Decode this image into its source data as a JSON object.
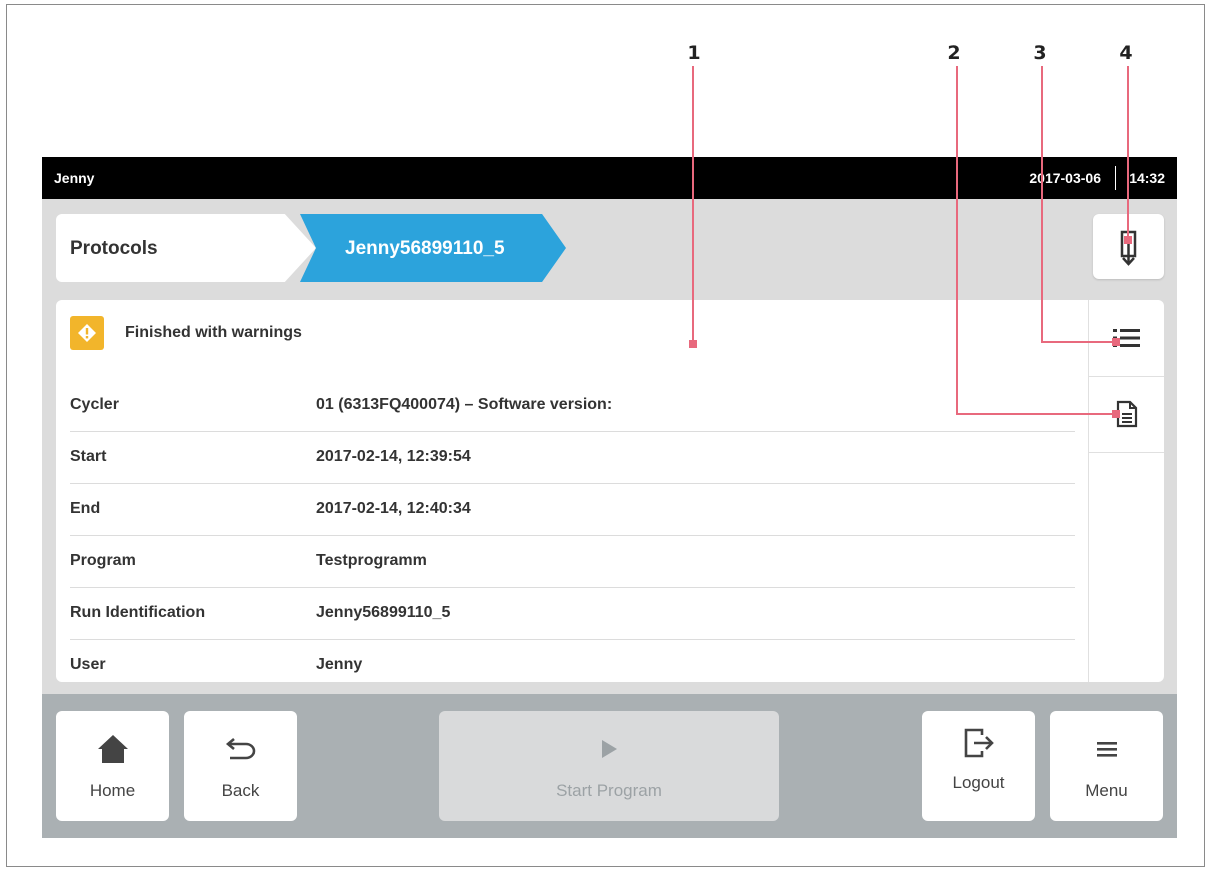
{
  "callouts": [
    "1",
    "2",
    "3",
    "4"
  ],
  "status_bar": {
    "user": "Jenny",
    "date": "2017-03-06",
    "time": "14:32"
  },
  "breadcrumb": {
    "items": [
      "Protocols",
      "Jenny56899110_5"
    ]
  },
  "panel": {
    "status_text": "Finished with warnings",
    "rows": [
      {
        "key": "Cycler",
        "value": "01 (6313FQ400074) – Software version:"
      },
      {
        "key": "Start",
        "value": "2017-02-14, 12:39:54"
      },
      {
        "key": "End",
        "value": "2017-02-14, 12:40:34"
      },
      {
        "key": "Program",
        "value": "Testprogramm"
      },
      {
        "key": "Run Identification",
        "value": "Jenny56899110_5"
      },
      {
        "key": "User",
        "value": "Jenny"
      }
    ]
  },
  "icons": {
    "export": "export-icon",
    "list": "list-icon",
    "report": "report-document-icon",
    "warning": "warning-icon",
    "home": "home-icon",
    "back": "back-icon",
    "play": "play-icon",
    "logout": "logout-icon",
    "menu": "menu-icon"
  },
  "bottom_bar": {
    "home_label": "Home",
    "back_label": "Back",
    "start_label": "Start Program",
    "logout_label": "Logout",
    "menu_label": "Menu"
  },
  "colors": {
    "accent": "#2ca3dc",
    "warning": "#f2b52b",
    "callout_line": "#e8697d",
    "status_bar": "#000000"
  }
}
